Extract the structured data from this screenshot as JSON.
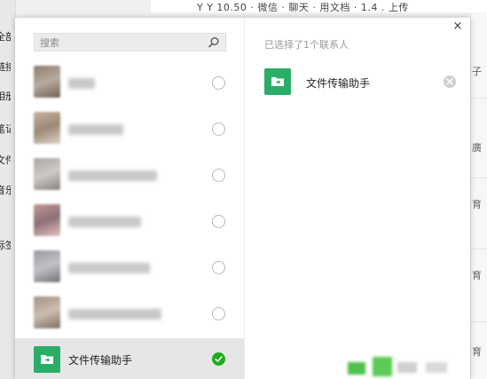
{
  "background": {
    "left_items": [
      "全部",
      "链接",
      "相册",
      "笔记",
      "文件",
      "音乐",
      "标签"
    ],
    "topbar_text": "Y Y 10.50 · 微信 · 聊天 · 用文档 · 1.4 . 上传",
    "right_items": [
      "子",
      "廣",
      "育",
      "育",
      "育"
    ]
  },
  "search": {
    "placeholder": "搜索",
    "icon": "search-icon"
  },
  "contacts": [
    {
      "avatar_colors": [
        "#8c7b6e",
        "#b9ab9f",
        "#6d5e52"
      ],
      "name_width": 30,
      "selected": false
    },
    {
      "avatar_colors": [
        "#c4b39c",
        "#9c8977",
        "#ddd2c4"
      ],
      "name_width": 62,
      "selected": false
    },
    {
      "avatar_colors": [
        "#a8a6a6",
        "#cfcac7",
        "#857f7d"
      ],
      "name_width": 100,
      "selected": false
    },
    {
      "avatar_colors": [
        "#c49a94",
        "#8c7078",
        "#e2c3bb"
      ],
      "name_width": 82,
      "selected": false
    },
    {
      "avatar_colors": [
        "#9a98a0",
        "#c4c0c8",
        "#75727a"
      ],
      "name_width": 92,
      "selected": false
    },
    {
      "avatar_colors": [
        "#a29184",
        "#cbbdb0",
        "#7d6e62"
      ],
      "name_width": 105,
      "selected": false
    }
  ],
  "file_helper": {
    "name": "文件传输助手",
    "selected": true,
    "color": "#2aae67"
  },
  "right_pane": {
    "selected_count_text": "已选择了1个联系人",
    "selected_item_name": "文件传输助手",
    "close_label": "×"
  },
  "colors": {
    "accent": "#1aad19",
    "helper_green": "#2aae67",
    "selected_row_bg": "#e6e6e6"
  }
}
